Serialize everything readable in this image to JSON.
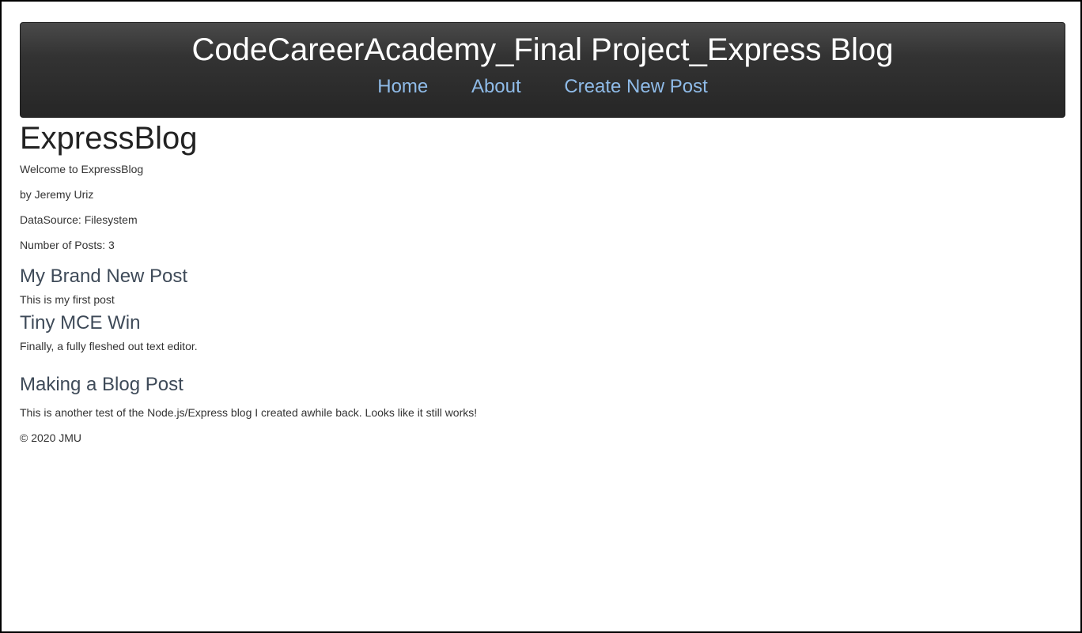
{
  "header": {
    "site_title": "CodeCareerAcademy_Final Project_Express Blog",
    "nav": [
      {
        "label": "Home"
      },
      {
        "label": "About"
      },
      {
        "label": "Create New Post"
      }
    ]
  },
  "main": {
    "title": "ExpressBlog",
    "welcome": "Welcome to ExpressBlog",
    "author": "by Jeremy Uriz",
    "datasource": "DataSource: Filesystem",
    "post_count": "Number of Posts: 3",
    "posts": [
      {
        "title": "My Brand New Post",
        "body": "This is my first post"
      },
      {
        "title": "Tiny MCE Win",
        "body": "Finally, a fully fleshed out text editor."
      },
      {
        "title": "Making a Blog Post",
        "body": "This is another test of the Node.js/Express blog I created awhile back. Looks like it still works!"
      }
    ]
  },
  "footer": {
    "copyright": "© 2020 JMU"
  },
  "colors": {
    "navbar_bg": "#333333",
    "nav_link": "#8fbbe8",
    "post_title": "#3e4a58"
  }
}
